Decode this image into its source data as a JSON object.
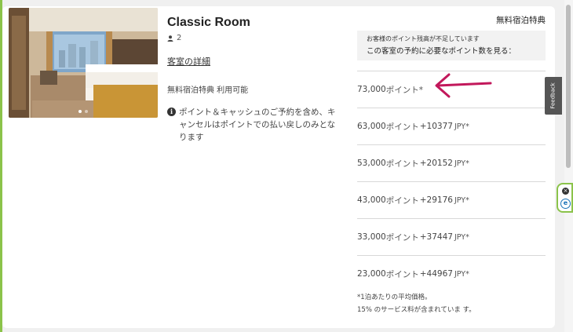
{
  "room": {
    "title": "Classic Room",
    "guests": "2",
    "details_link": "客室の詳細",
    "availability": "無料宿泊特典 利用可能",
    "note": "ポイント＆キャッシュのご予約を含め、キャンセルはポイントでの払い戻しのみとなります"
  },
  "carousel": {
    "slides": 2,
    "active": 0
  },
  "rates_panel": {
    "header": "無料宿泊特典",
    "insufficient_line1": "お客様のポイント残高が不足しています",
    "insufficient_line2": "この客室の予約に必要なポイント数を見る：",
    "rates": [
      {
        "points": "73,000",
        "points_unit": "ポイント*",
        "cash": "",
        "currency": ""
      },
      {
        "points": "63,000",
        "points_unit": "ポイント",
        "cash": "+10377",
        "currency": "JPY*"
      },
      {
        "points": "53,000",
        "points_unit": "ポイント",
        "cash": "+20152",
        "currency": "JPY*"
      },
      {
        "points": "43,000",
        "points_unit": "ポイント",
        "cash": "+29176",
        "currency": "JPY*"
      },
      {
        "points": "33,000",
        "points_unit": "ポイント",
        "cash": "+37447",
        "currency": "JPY*"
      },
      {
        "points": "23,000",
        "points_unit": "ポイント",
        "cash": "+44967",
        "currency": "JPY*"
      }
    ],
    "footnote_line1": "*1泊あたりの平均価格。",
    "footnote_line2": "15% のサービス料が含まれていま す。"
  },
  "feedback_tab": "Feedback",
  "extension": {
    "close": "×",
    "logo": "e"
  },
  "colors": {
    "accent_green": "#8bc34a",
    "arrow": "#c2185b",
    "ext_blue": "#1a73b8"
  }
}
